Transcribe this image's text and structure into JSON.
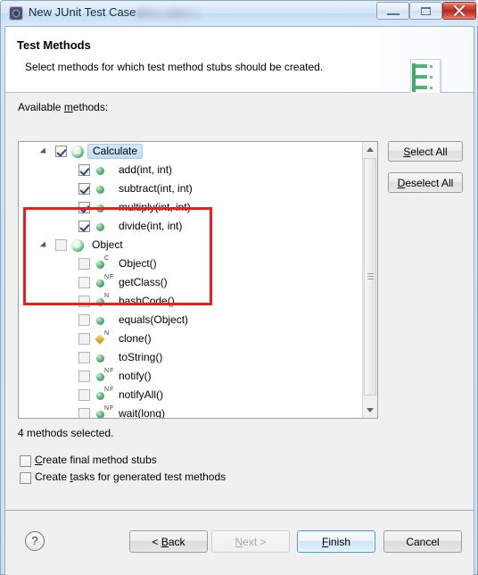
{
  "window": {
    "title": "New JUnit Test Case",
    "icon": "junit-icon",
    "buttons": {
      "minimize": "minimize-icon",
      "maximize": "maximize-icon",
      "close": "close-icon"
    }
  },
  "header": {
    "title": "Test Methods",
    "description": "Select methods for which test method stubs should be created.",
    "icon": "junit-wizard-banner-icon"
  },
  "body": {
    "available_label_pre": "Available ",
    "available_label_mnemonic": "m",
    "available_label_post": "ethods:",
    "select_all_pre": "",
    "select_all_mnemonic": "S",
    "select_all_post": "elect All",
    "deselect_all_pre": "",
    "deselect_all_mnemonic": "D",
    "deselect_all_post": "eselect All",
    "methods_selected": "4 methods selected.",
    "options": [
      {
        "id": "create-final-method-stubs",
        "pre": "Create final method stubs",
        "mnemonic": "C",
        "label_a": "",
        "label_b": "reate final method stubs",
        "checked": false
      },
      {
        "id": "create-tasks-for-generated-test-methods",
        "pre": "Create ",
        "mnemonic": "t",
        "label_a": "Create ",
        "label_b": "asks for generated test methods",
        "checked": false
      }
    ]
  },
  "tree": {
    "nodes": [
      {
        "label": "Calculate",
        "indent": 0,
        "type": "class",
        "icon": "class-icon-green-c",
        "checked": true,
        "selected": true,
        "expanded": true,
        "modifiers": ""
      },
      {
        "label": "add(int, int)",
        "indent": 1,
        "type": "method",
        "icon": "method-public-icon",
        "checked": true,
        "selected": false,
        "modifiers": ""
      },
      {
        "label": "subtract(int, int)",
        "indent": 1,
        "type": "method",
        "icon": "method-public-icon",
        "checked": true,
        "selected": false,
        "modifiers": ""
      },
      {
        "label": "multiply(int, int)",
        "indent": 1,
        "type": "method",
        "icon": "method-public-icon",
        "checked": true,
        "selected": false,
        "modifiers": ""
      },
      {
        "label": "divide(int, int)",
        "indent": 1,
        "type": "method",
        "icon": "method-public-icon",
        "checked": true,
        "selected": false,
        "modifiers": ""
      },
      {
        "label": "Object",
        "indent": 0,
        "type": "class",
        "icon": "class-icon-green-c",
        "checked": false,
        "selected": false,
        "expanded": true,
        "modifiers": ""
      },
      {
        "label": "Object()",
        "indent": 1,
        "type": "method",
        "icon": "method-public-icon",
        "checked": false,
        "selected": false,
        "modifiers": "C"
      },
      {
        "label": "getClass()",
        "indent": 1,
        "type": "method",
        "icon": "method-public-icon",
        "checked": false,
        "selected": false,
        "modifiers": "NF"
      },
      {
        "label": "hashCode()",
        "indent": 1,
        "type": "method",
        "icon": "method-public-icon",
        "checked": false,
        "selected": false,
        "modifiers": "N"
      },
      {
        "label": "equals(Object)",
        "indent": 1,
        "type": "method",
        "icon": "method-public-icon",
        "checked": false,
        "selected": false,
        "modifiers": ""
      },
      {
        "label": "clone()",
        "indent": 1,
        "type": "method",
        "icon": "method-protected-icon",
        "checked": false,
        "selected": false,
        "modifiers": "N"
      },
      {
        "label": "toString()",
        "indent": 1,
        "type": "method",
        "icon": "method-public-icon",
        "checked": false,
        "selected": false,
        "modifiers": ""
      },
      {
        "label": "notify()",
        "indent": 1,
        "type": "method",
        "icon": "method-public-icon",
        "checked": false,
        "selected": false,
        "modifiers": "NF"
      },
      {
        "label": "notifyAll()",
        "indent": 1,
        "type": "method",
        "icon": "method-public-icon",
        "checked": false,
        "selected": false,
        "modifiers": "NF"
      },
      {
        "label": "wait(long)",
        "indent": 1,
        "type": "method",
        "icon": "method-public-icon",
        "checked": false,
        "selected": false,
        "modifiers": "NF"
      }
    ]
  },
  "footer": {
    "help": "?",
    "back_pre": "< ",
    "back_mnemonic": "B",
    "back_post": "ack",
    "next_pre": "",
    "next_mnemonic": "N",
    "next_post": "ext >",
    "finish_pre": "",
    "finish_mnemonic": "F",
    "finish_post": "inish",
    "cancel": "Cancel"
  },
  "annotation": {
    "color": "#ee1c1c",
    "shape": "rectangle-highlight"
  }
}
